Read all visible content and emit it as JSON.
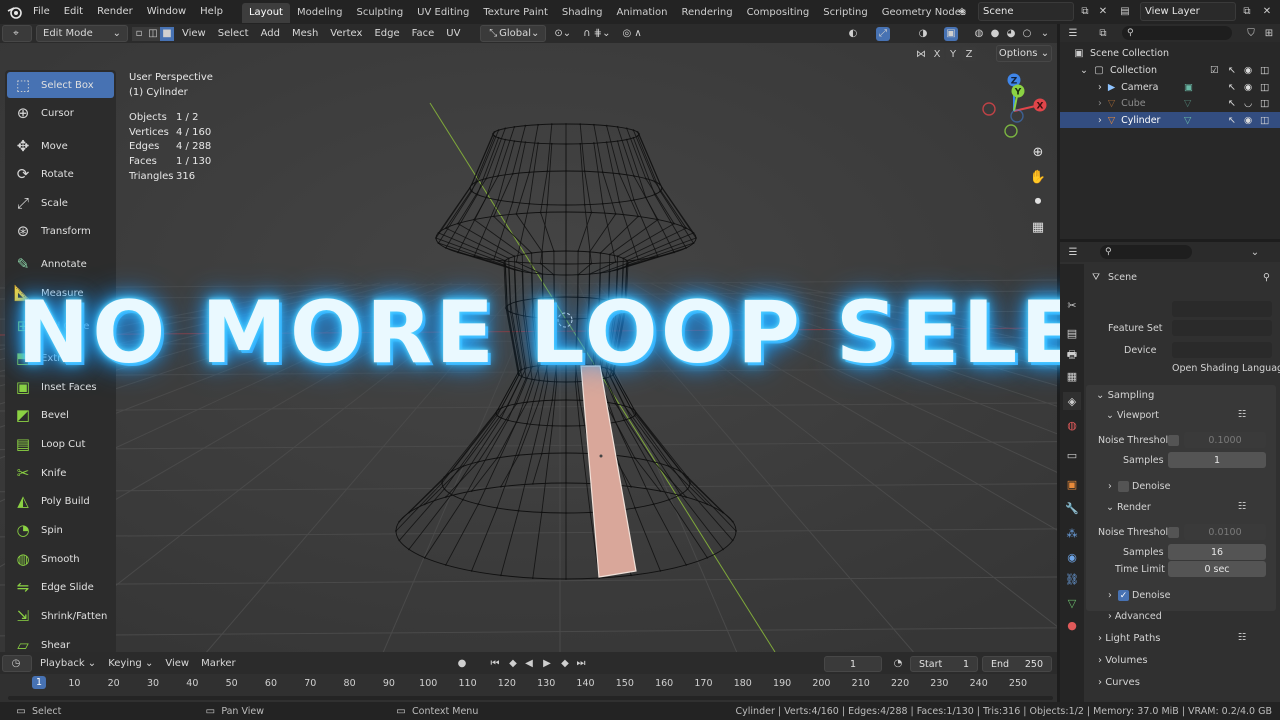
{
  "topbar": {
    "menus": [
      "File",
      "Edit",
      "Render",
      "Window",
      "Help"
    ],
    "workspaces": [
      "Layout",
      "Modeling",
      "Sculpting",
      "UV Editing",
      "Texture Paint",
      "Shading",
      "Animation",
      "Rendering",
      "Compositing",
      "Scripting",
      "Geometry Nodes"
    ],
    "active_workspace": "Layout",
    "add_tab": "+",
    "scene": "Scene",
    "view_layer": "View Layer"
  },
  "viewport_header": {
    "mode": "Edit Mode",
    "menus": [
      "View",
      "Select",
      "Add",
      "Mesh",
      "Vertex",
      "Edge",
      "Face",
      "UV"
    ],
    "orientation": "Global",
    "options": "Options",
    "axes": [
      "X",
      "Y",
      "Z"
    ]
  },
  "viewport": {
    "perspective": "User Perspective",
    "object_name": "(1) Cylinder",
    "stats": [
      {
        "label": "Objects",
        "value": "1 / 2"
      },
      {
        "label": "Vertices",
        "value": "4 / 160"
      },
      {
        "label": "Edges",
        "value": "4 / 288"
      },
      {
        "label": "Faces",
        "value": "1 / 130"
      },
      {
        "label": "Triangles",
        "value": "316"
      }
    ],
    "headline": "NO MORE LOOP SELECT?",
    "gizmo_axes": [
      "Z",
      "Y",
      "X"
    ]
  },
  "toolbar": {
    "tools": [
      {
        "label": "Select Box",
        "icon": "select-box-icon",
        "active": true
      },
      {
        "label": "Cursor",
        "icon": "cursor-icon"
      },
      {
        "label": "Move",
        "icon": "move-icon"
      },
      {
        "label": "Rotate",
        "icon": "rotate-icon"
      },
      {
        "label": "Scale",
        "icon": "scale-icon"
      },
      {
        "label": "Transform",
        "icon": "transform-icon"
      },
      {
        "label": "Annotate",
        "icon": "annotate-icon"
      },
      {
        "label": "Measure",
        "icon": "measure-icon"
      },
      {
        "label": "Add Cube",
        "icon": "add-cube-icon"
      },
      {
        "label": "Extrude",
        "icon": "extrude-icon"
      },
      {
        "label": "Inset Faces",
        "icon": "inset-faces-icon"
      },
      {
        "label": "Bevel",
        "icon": "bevel-icon"
      },
      {
        "label": "Loop Cut",
        "icon": "loop-cut-icon"
      },
      {
        "label": "Knife",
        "icon": "knife-icon"
      },
      {
        "label": "Poly Build",
        "icon": "poly-build-icon"
      },
      {
        "label": "Spin",
        "icon": "spin-icon"
      },
      {
        "label": "Smooth",
        "icon": "smooth-icon"
      },
      {
        "label": "Edge Slide",
        "icon": "edge-slide-icon"
      },
      {
        "label": "Shrink/Fatten",
        "icon": "shrink-fatten-icon"
      },
      {
        "label": "Shear",
        "icon": "shear-icon"
      }
    ]
  },
  "outliner": {
    "root": "Scene Collection",
    "collection": "Collection",
    "items": [
      {
        "name": "Camera"
      },
      {
        "name": "Cube"
      },
      {
        "name": "Cylinder",
        "selected": true
      }
    ]
  },
  "properties": {
    "context": "Scene",
    "feature_set_label": "Feature Set",
    "device_label": "Device",
    "shading_lang": "Open Shading Language",
    "sampling": "Sampling",
    "viewport": "Viewport",
    "noise_threshold_label": "Noise Threshold",
    "viewport_noise": "0.1000",
    "samples_label": "Samples",
    "viewport_samples": "1",
    "denoise": "Denoise",
    "render": "Render",
    "render_noise": "0.0100",
    "render_samples": "16",
    "time_limit_label": "Time Limit",
    "time_limit": "0 sec",
    "advanced": "Advanced",
    "light_paths": "Light Paths",
    "volumes": "Volumes",
    "curves": "Curves"
  },
  "timeline": {
    "menus": [
      "Playback",
      "Keying",
      "View",
      "Marker"
    ],
    "current_frame": "1",
    "start_label": "Start",
    "start": "1",
    "end_label": "End",
    "end": "250",
    "ticks": [
      "1",
      "10",
      "20",
      "30",
      "40",
      "50",
      "60",
      "70",
      "80",
      "90",
      "100",
      "110",
      "120",
      "130",
      "140",
      "150",
      "160",
      "170",
      "180",
      "190",
      "200",
      "210",
      "220",
      "230",
      "240",
      "250"
    ]
  },
  "statusbar": {
    "select": "Select",
    "pan": "Pan View",
    "context": "Context Menu",
    "info": "Cylinder | Verts:4/160 | Edges:4/288 | Faces:1/130 | Tris:316 | Objects:1/2 | Memory: 37.0 MiB | VRAM: 0.2/4.0 GB"
  },
  "colors": {
    "accent": "#4772b3",
    "selected_face": "#d9a79a",
    "headline_glow": "#3ec8ff",
    "x_axis": "#e0454a",
    "y_axis": "#8bd243",
    "z_axis": "#3f86ea"
  }
}
